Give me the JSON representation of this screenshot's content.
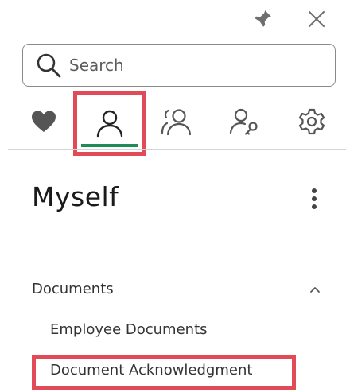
{
  "search": {
    "placeholder": "Search",
    "value": ""
  },
  "tabs": [
    {
      "id": "favorites",
      "icon": "heart-icon",
      "active": false
    },
    {
      "id": "myself",
      "icon": "person-icon",
      "active": true
    },
    {
      "id": "team",
      "icon": "people-icon",
      "active": false
    },
    {
      "id": "access",
      "icon": "person-key-icon",
      "active": false
    },
    {
      "id": "settings",
      "icon": "gear-icon",
      "active": false
    }
  ],
  "page": {
    "title": "Myself"
  },
  "section": {
    "title": "Documents",
    "expanded": true,
    "items": [
      {
        "label": "Employee Documents"
      },
      {
        "label": "Document Acknowledgment"
      }
    ]
  },
  "colors": {
    "accent_green": "#1f8b57",
    "highlight_red": "#e04b57",
    "icon_gray": "#555555"
  }
}
